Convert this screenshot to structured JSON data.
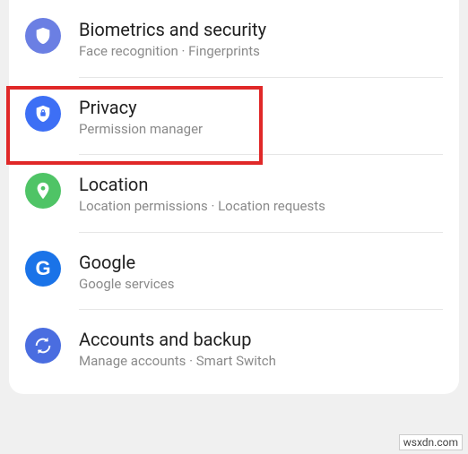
{
  "items": [
    {
      "icon": "shield",
      "icon_color": "blue",
      "title": "Biometrics and security",
      "subtitle": "Face recognition  ·  Fingerprints"
    },
    {
      "icon": "lock-shield",
      "icon_color": "blue-strong",
      "title": "Privacy",
      "subtitle": "Permission manager"
    },
    {
      "icon": "location",
      "icon_color": "green",
      "title": "Location",
      "subtitle": "Location permissions  ·  Location requests"
    },
    {
      "icon": "google",
      "icon_color": "google-blue",
      "title": "Google",
      "subtitle": "Google services"
    },
    {
      "icon": "sync",
      "icon_color": "circle-blue",
      "title": "Accounts and backup",
      "subtitle": "Manage accounts  ·  Smart Switch"
    }
  ],
  "highlight": {
    "color": "#e02828"
  },
  "watermark": "wsxdn.com"
}
